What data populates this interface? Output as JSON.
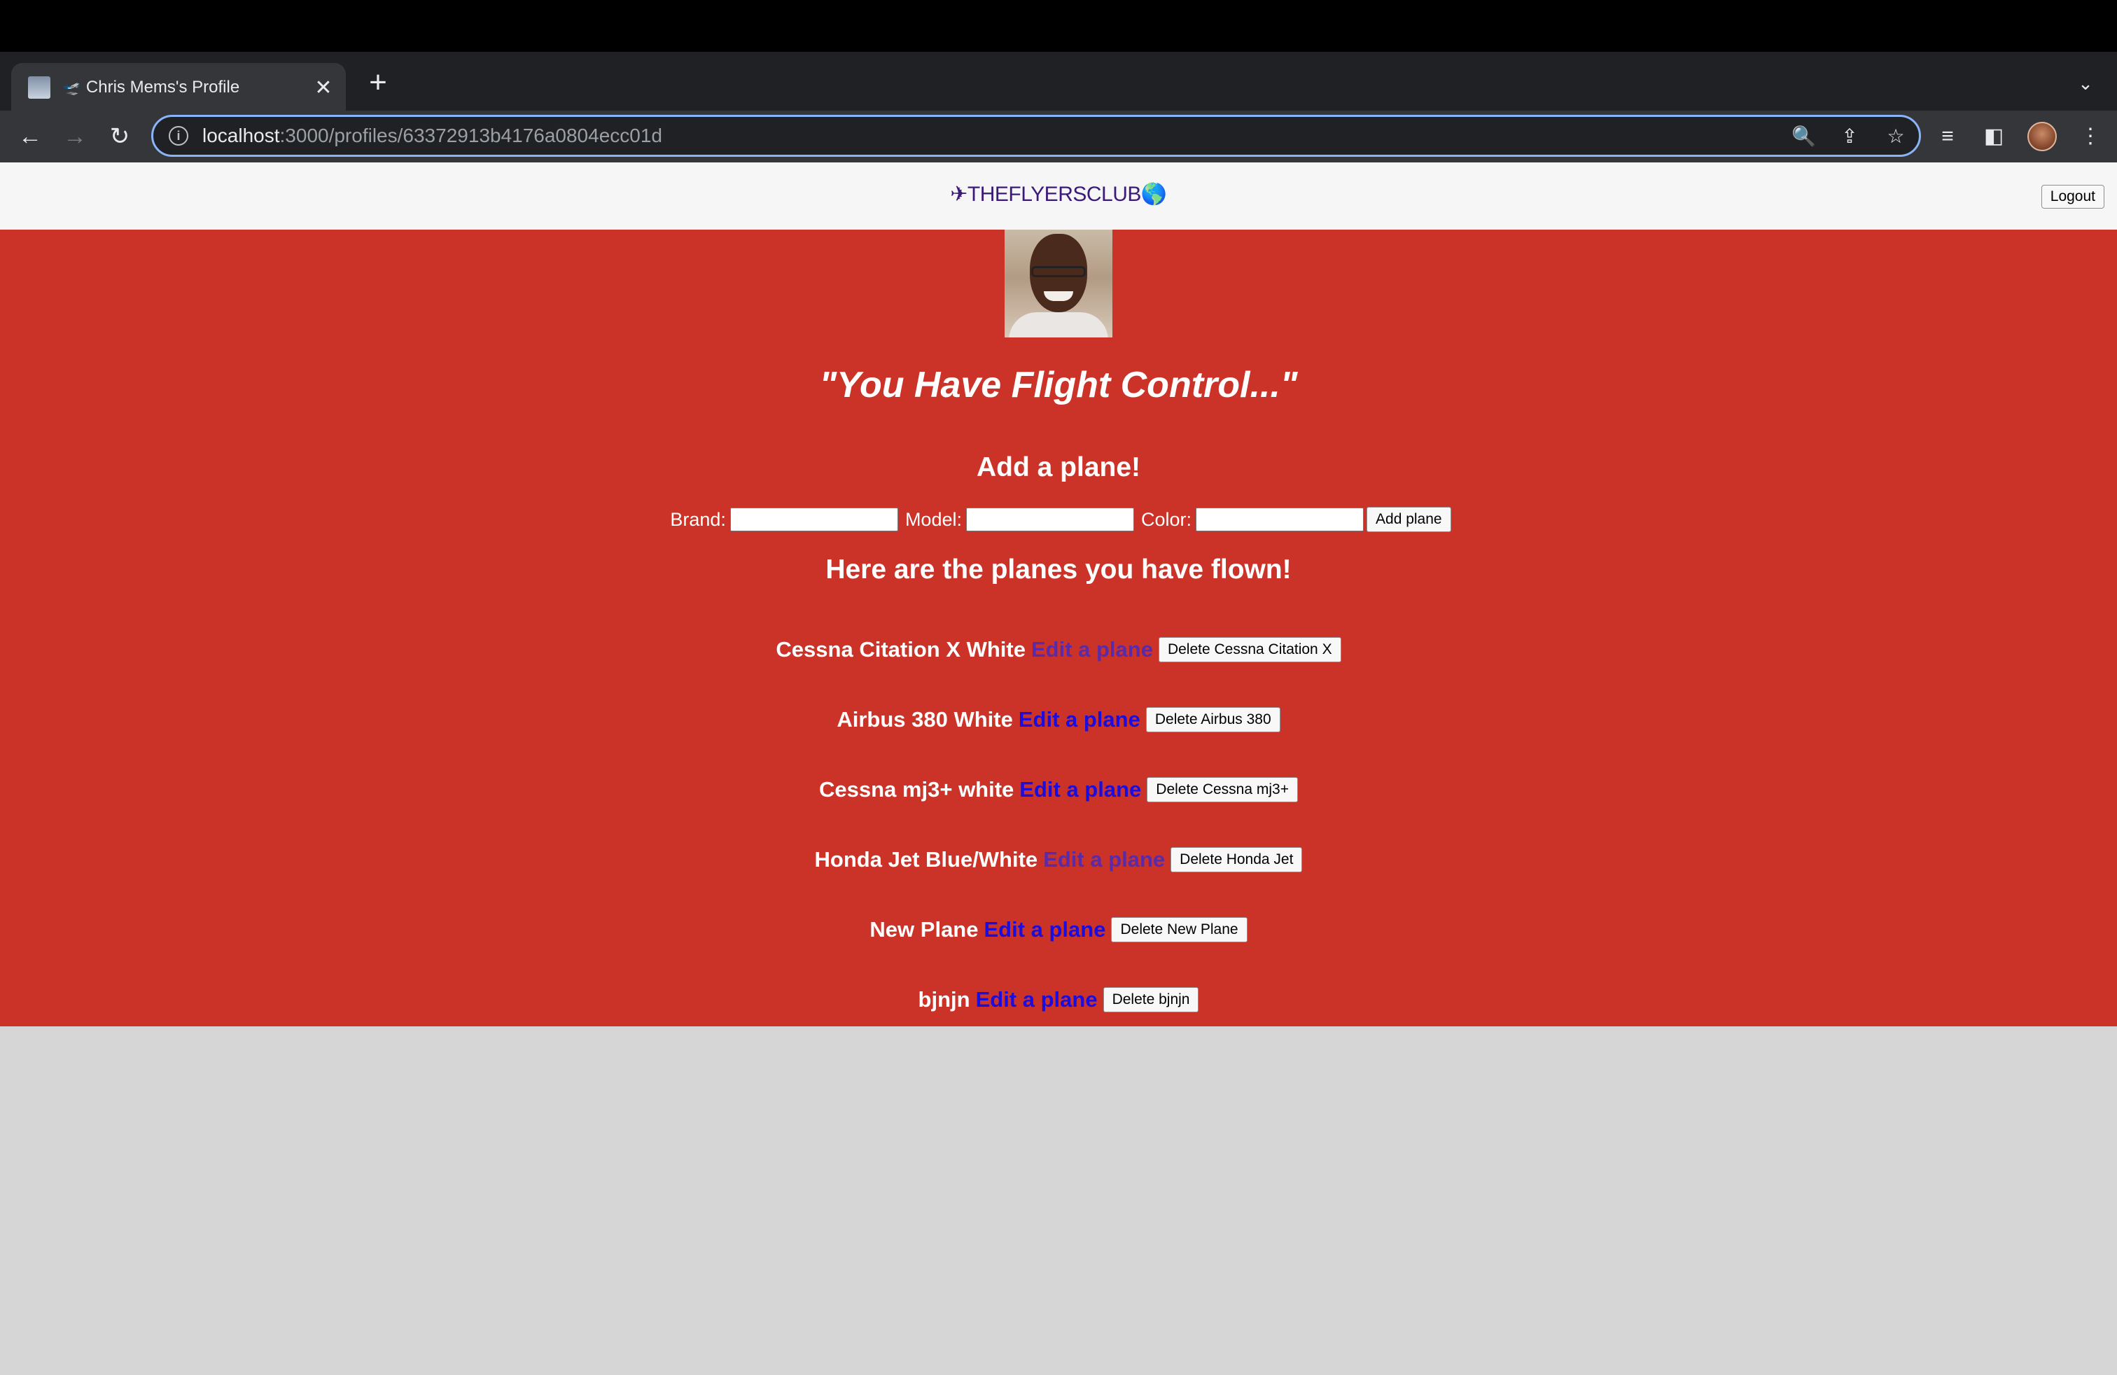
{
  "browser": {
    "tab": {
      "title": "Chris Mems's Profile",
      "plane_glyph": "🛫",
      "close": "✕"
    },
    "new_tab": "+",
    "tab_dropdown": "⌄",
    "nav": {
      "back": "←",
      "forward": "→",
      "reload": "↻"
    },
    "url": {
      "host": "localhost",
      "path": ":3000/profiles/63372913b4176a0804ecc01d"
    },
    "omnibox_icons": {
      "zoom": "🔍",
      "share": "⇪",
      "star": "☆"
    },
    "toolbar_icons": {
      "reading_list": "≡",
      "side_panel": "◧",
      "menu": "⋮"
    }
  },
  "header": {
    "brand": "✈THEFLYERSCLUB🌎",
    "logout_label": "Logout"
  },
  "profile": {
    "quote": "\"You Have Flight Control...\""
  },
  "add_form": {
    "title": "Add a plane!",
    "brand_label": "Brand:",
    "model_label": "Model:",
    "color_label": "Color:",
    "submit_label": "Add plane"
  },
  "planes_title": "Here are the planes you have flown!",
  "planes": [
    {
      "name": "Cessna Citation X White",
      "edit_label": "Edit a plane",
      "delete_label": "Delete Cessna Citation X"
    },
    {
      "name": "Airbus 380 White",
      "edit_label": "Edit a plane",
      "delete_label": "Delete Airbus 380"
    },
    {
      "name": "Cessna mj3+ white",
      "edit_label": "Edit a plane",
      "delete_label": "Delete Cessna mj3+"
    },
    {
      "name": "Honda Jet Blue/White",
      "edit_label": "Edit a plane",
      "delete_label": "Delete Honda Jet"
    },
    {
      "name": "New Plane",
      "edit_label": "Edit a plane",
      "delete_label": "Delete New Plane"
    },
    {
      "name": "bjnjn",
      "edit_label": "Edit a plane",
      "delete_label": "Delete bjnjn"
    }
  ],
  "colors": {
    "main_bg": "#cb3328",
    "link": "#1a0dde",
    "link_visited": "#5a2aa8",
    "brand": "#3b1a7a"
  }
}
